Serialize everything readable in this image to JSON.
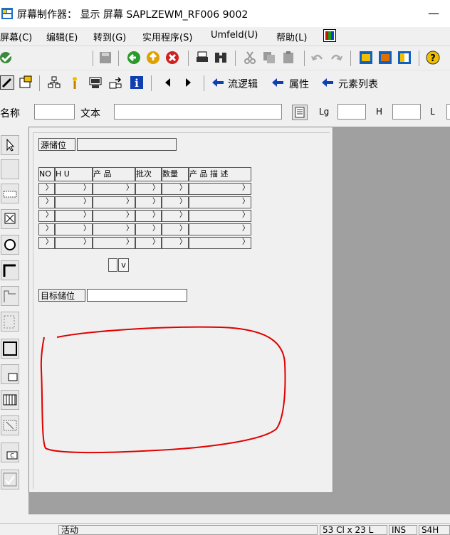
{
  "window": {
    "title": "屏幕制作器： 显示 屏幕 SAPLZEWM_RF006 9002",
    "minimize_label": "—"
  },
  "menu": [
    "屏幕(C)",
    "编辑(E)",
    "转到(G)",
    "实用程序(S)",
    "Umfeld(U)",
    "帮助(L)"
  ],
  "toolbar2": {
    "flow_logic": "流逻辑",
    "attributes": "属性",
    "element_list": "元素列表"
  },
  "attr_row": {
    "name_label": "名称",
    "text_label": "文本",
    "lg_label": "Lg",
    "h_label": "H",
    "l_label": "L"
  },
  "screen": {
    "source_bin_label": "源储位",
    "target_bin_label": "目标储位",
    "table_headers": [
      "NO",
      "H      U",
      "产  品",
      "批次",
      "数量",
      "产 品 描 述"
    ],
    "cell_marker": "〉",
    "row_count": 5,
    "scroll_down": "v"
  },
  "annotation": {
    "color": "#ff0000",
    "shape": "freehand-loop"
  },
  "status": {
    "mode": "活动",
    "position": "53 Cl x 23 L",
    "ins": "INS",
    "sys": "S4H"
  }
}
